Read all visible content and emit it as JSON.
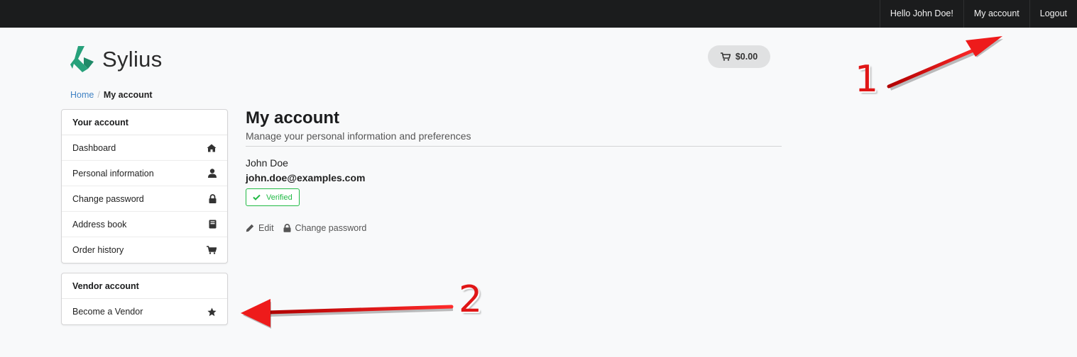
{
  "topbar": {
    "greeting": "Hello John Doe!",
    "my_account": "My account",
    "logout": "Logout"
  },
  "brand": {
    "name": "Sylius",
    "color": "#27a17b"
  },
  "cart": {
    "total": "$0.00",
    "icon": "cart-icon"
  },
  "breadcrumb": {
    "home": "Home",
    "separator": "/",
    "current": "My account"
  },
  "sidebar": {
    "account": {
      "header": "Your account",
      "items": [
        {
          "label": "Dashboard",
          "icon": "home-icon"
        },
        {
          "label": "Personal information",
          "icon": "user-icon"
        },
        {
          "label": "Change password",
          "icon": "lock-icon"
        },
        {
          "label": "Address book",
          "icon": "book-icon"
        },
        {
          "label": "Order history",
          "icon": "cart-icon"
        }
      ]
    },
    "vendor": {
      "header": "Vendor account",
      "items": [
        {
          "label": "Become a Vendor",
          "icon": "star-icon"
        }
      ]
    }
  },
  "main": {
    "title": "My account",
    "subtitle": "Manage your personal information and preferences",
    "user_name": "John Doe",
    "user_email": "john.doe@examples.com",
    "badge": "Verified",
    "actions": {
      "edit": "Edit",
      "change_password": "Change password"
    }
  },
  "annotations": {
    "one": "1",
    "two": "2",
    "color": "#e01616"
  }
}
